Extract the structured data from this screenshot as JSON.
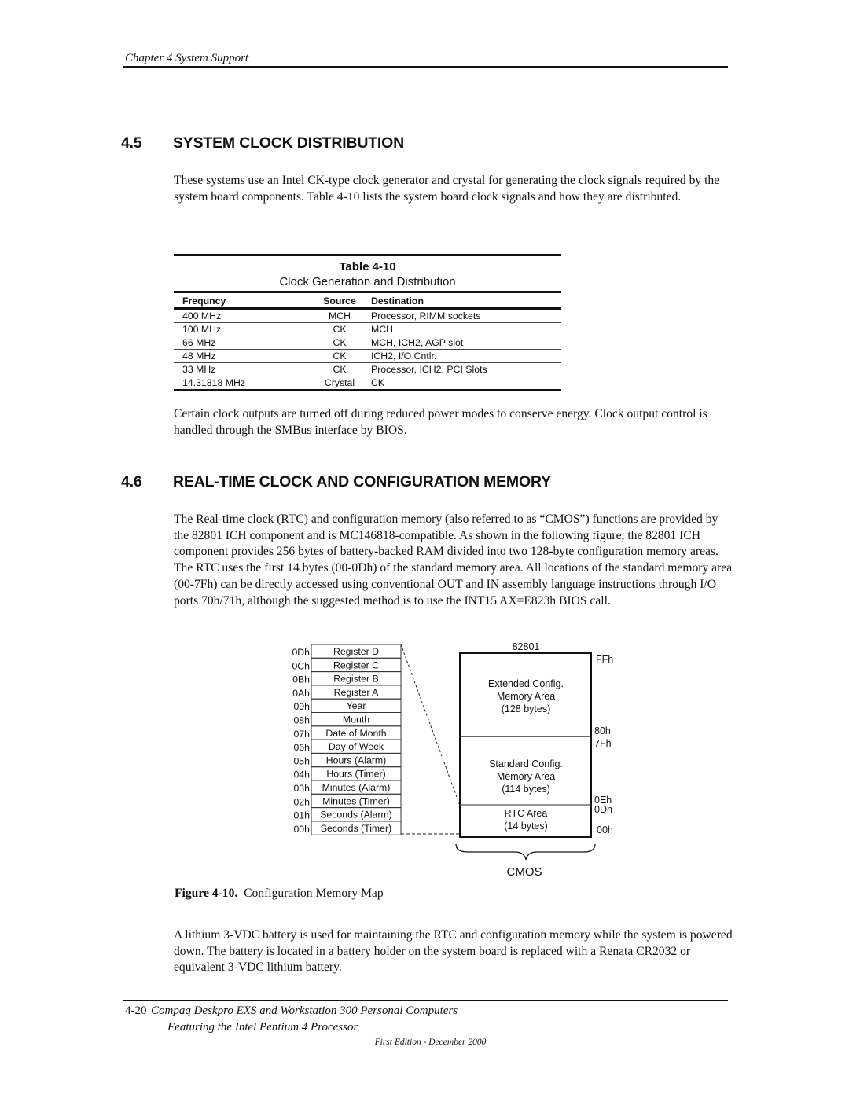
{
  "header": {
    "chapter": "Chapter 4  System Support"
  },
  "section_4_5": {
    "number": "4.5",
    "title": "SYSTEM CLOCK DISTRIBUTION",
    "intro": "These systems use an Intel CK-type clock generator and crystal for generating the clock signals required by the system board components. Table 4-10 lists the system board clock signals and how they are distributed.",
    "table": {
      "title": "Table 4-10",
      "caption": "Clock Generation and Distribution",
      "headers": [
        "Frequncy",
        "Source",
        "Destination"
      ],
      "rows": [
        [
          "400 MHz",
          "MCH",
          "Processor, RIMM sockets"
        ],
        [
          "100 MHz",
          "CK",
          "MCH"
        ],
        [
          "66 MHz",
          "CK",
          "MCH, ICH2, AGP slot"
        ],
        [
          "48 MHz",
          "CK",
          "ICH2, I/O Cntlr."
        ],
        [
          "33 MHz",
          "CK",
          "Processor, ICH2, PCI Slots"
        ],
        [
          "14.31818 MHz",
          "Crystal",
          "CK"
        ]
      ]
    },
    "after_table": "Certain clock outputs are turned off during reduced power modes to conserve energy. Clock output control is handled through the SMBus interface by BIOS."
  },
  "section_4_6": {
    "number": "4.6",
    "title": "REAL-TIME CLOCK AND CONFIGURATION MEMORY",
    "body": "The Real-time clock (RTC) and configuration memory (also referred to as “CMOS”) functions are provided by the 82801 ICH component and is MC146818-compatible. As shown in the following figure, the 82801 ICH component provides 256 bytes of battery-backed RAM divided into two 128-byte configuration memory areas.  The RTC uses the first 14 bytes (00-0Dh) of the standard memory area. All locations of the standard memory area (00-7Fh) can be directly accessed using conventional OUT and IN assembly language instructions through I/O ports 70h/71h, although the suggested method is to use the INT15 AX=E823h BIOS call.",
    "figure": {
      "registers": [
        {
          "addr": "0Dh",
          "name": "Register D"
        },
        {
          "addr": "0Ch",
          "name": "Register C"
        },
        {
          "addr": "0Bh",
          "name": "Register B"
        },
        {
          "addr": "0Ah",
          "name": "Register A"
        },
        {
          "addr": "09h",
          "name": "Year"
        },
        {
          "addr": "08h",
          "name": "Month"
        },
        {
          "addr": "07h",
          "name": "Date of Month"
        },
        {
          "addr": "06h",
          "name": "Day of Week"
        },
        {
          "addr": "05h",
          "name": "Hours (Alarm)"
        },
        {
          "addr": "04h",
          "name": "Hours (Timer)"
        },
        {
          "addr": "03h",
          "name": "Minutes (Alarm)"
        },
        {
          "addr": "02h",
          "name": "Minutes (Timer)"
        },
        {
          "addr": "01h",
          "name": "Seconds (Alarm)"
        },
        {
          "addr": "00h",
          "name": "Seconds (Timer)"
        }
      ],
      "chip_label": "82801",
      "areas": {
        "extended": [
          "Extended Config.",
          "Memory Area",
          "(128 bytes)"
        ],
        "standard": [
          "Standard Config.",
          "Memory Area",
          "(114 bytes)"
        ],
        "rtc": [
          "RTC Area",
          "(14 bytes)"
        ]
      },
      "addr_labels": {
        "ffh": "FFh",
        "80h": "80h",
        "7fh": "7Fh",
        "0eh": "0Eh",
        "0dh": "0Dh",
        "00h": "00h"
      },
      "brace_label": "CMOS",
      "caption_bold": "Figure 4-10.",
      "caption_text": "Configuration Memory Map"
    },
    "battery": "A lithium 3-VDC battery is used for maintaining the RTC and configuration memory while the system is powered down. The battery is located in a battery holder on the system board is replaced with a Renata CR2032 or equivalent 3-VDC lithium battery."
  },
  "footer": {
    "page": "4-20",
    "title_line1": "Compaq Deskpro EXS and Workstation 300 Personal Computers",
    "title_line2": "Featuring the Intel Pentium 4 Processor",
    "edition": "First Edition - December 2000"
  }
}
